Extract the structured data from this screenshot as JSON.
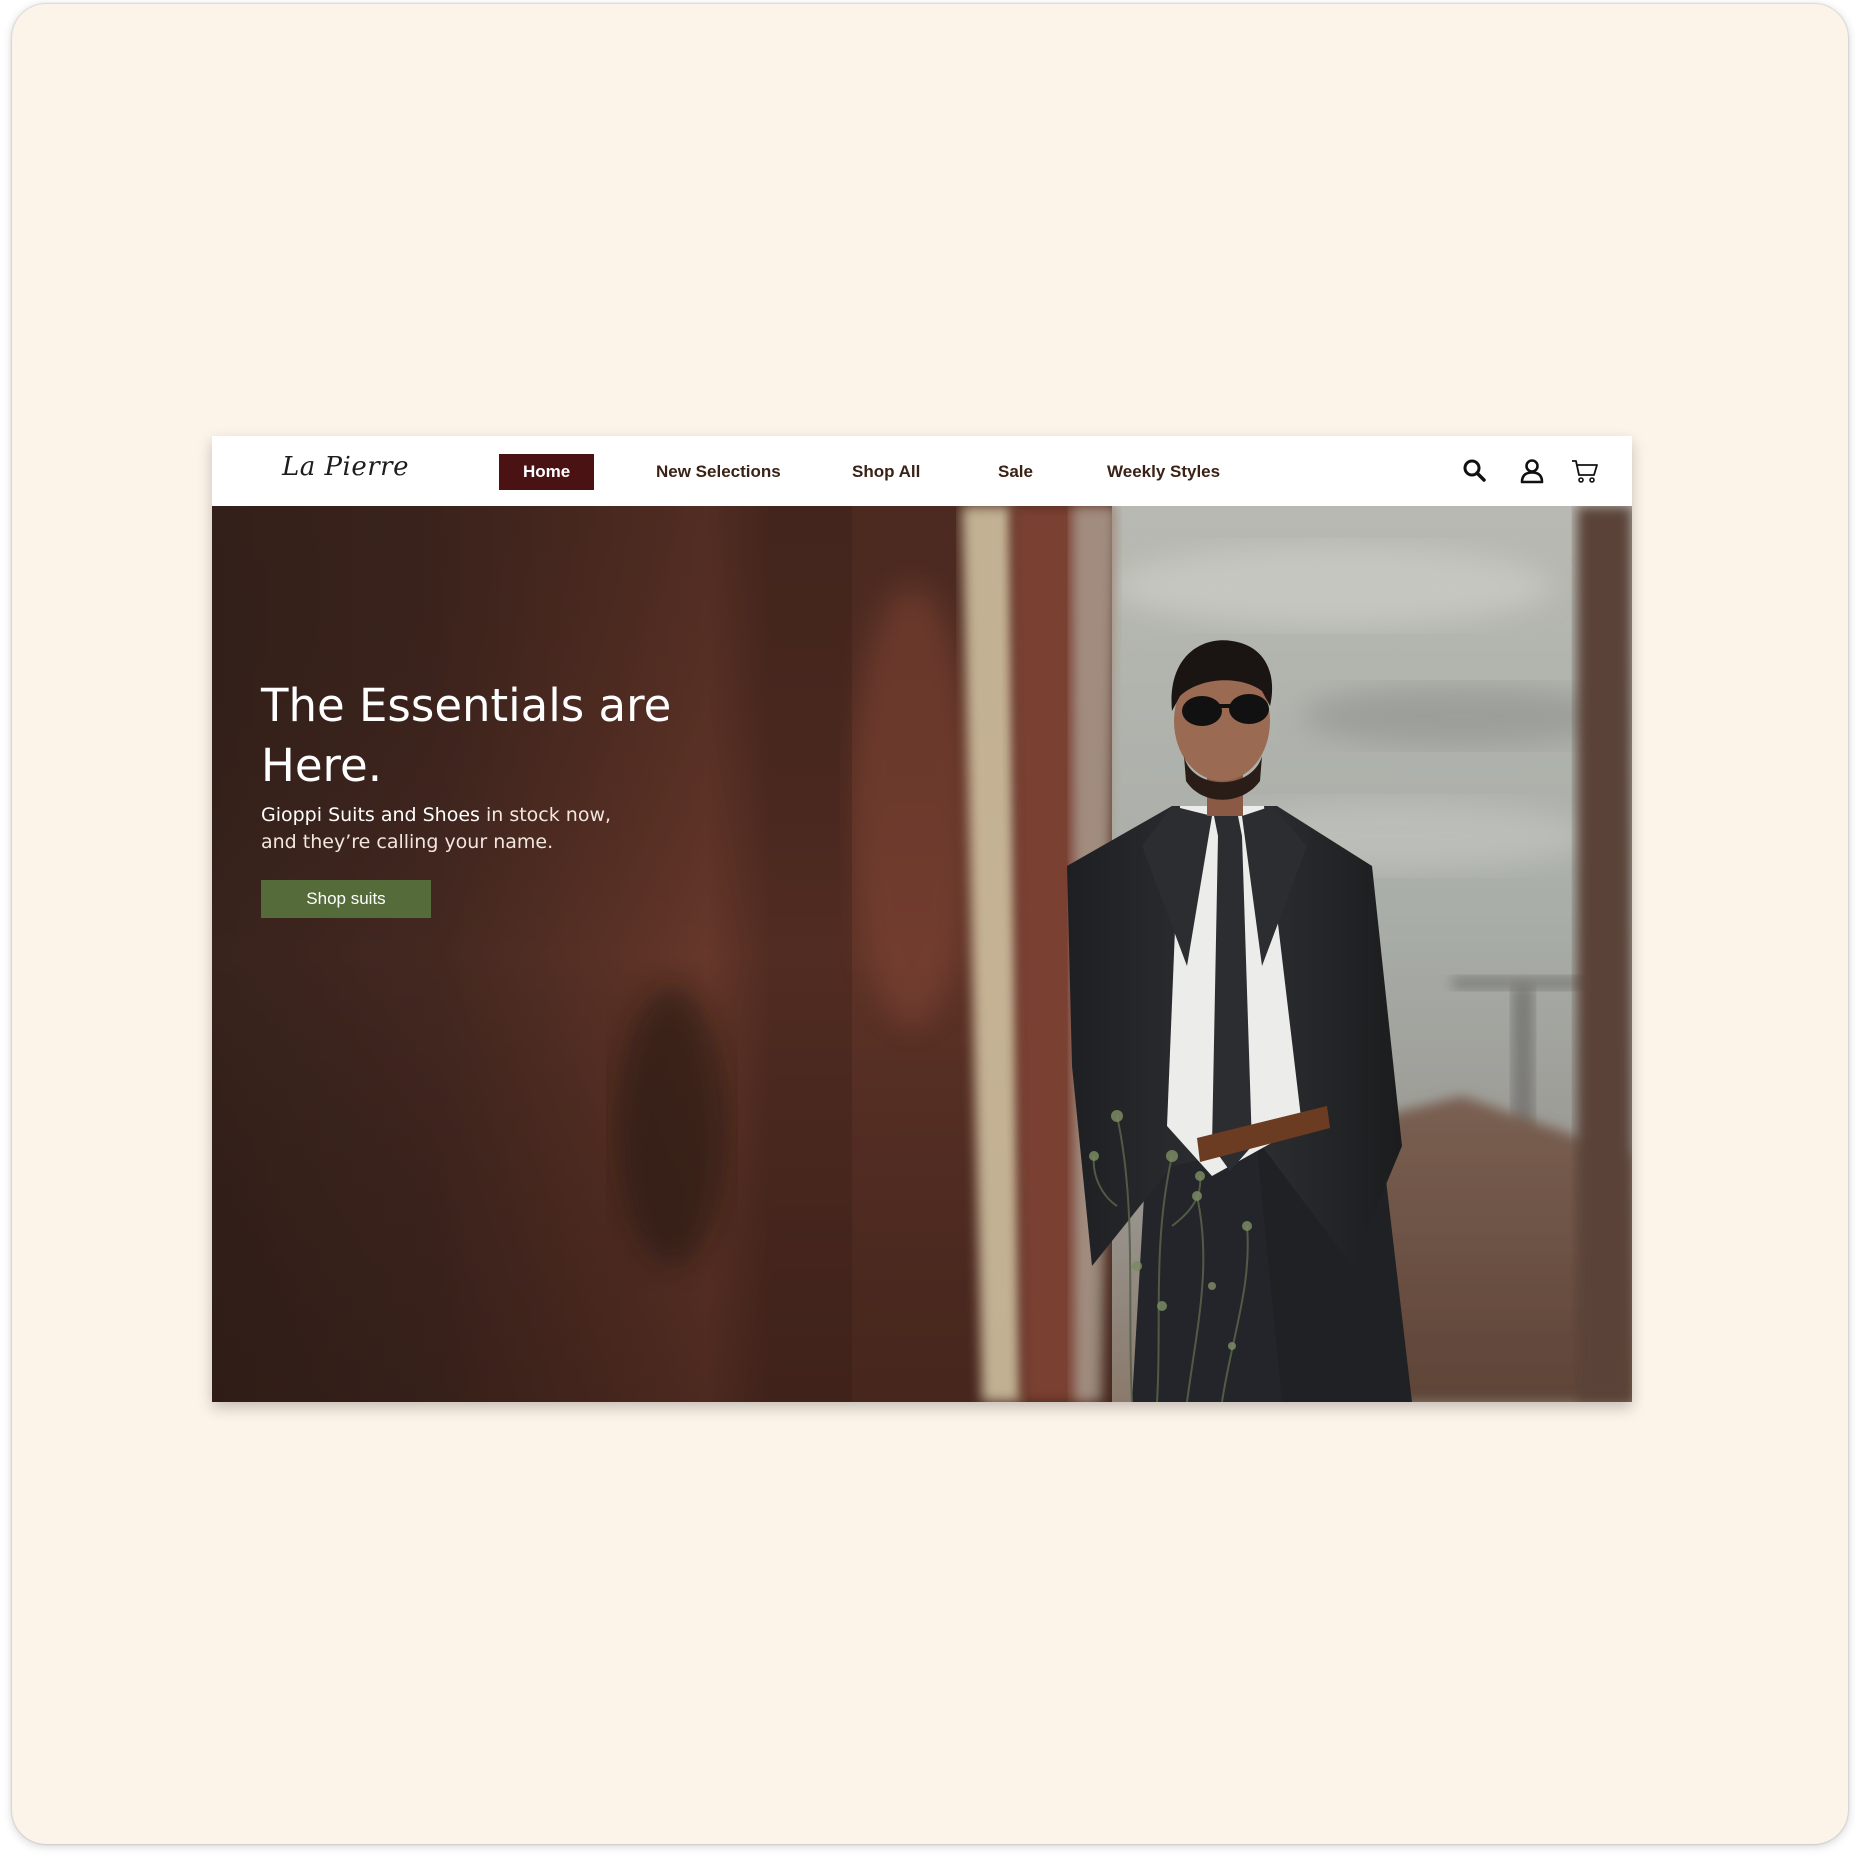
{
  "brand": {
    "logo_text": "La Pierre"
  },
  "nav": {
    "items": [
      {
        "label": "Home",
        "active": true
      },
      {
        "label": "New Selections",
        "active": false
      },
      {
        "label": "Shop All",
        "active": false
      },
      {
        "label": "Sale",
        "active": false
      },
      {
        "label": "Weekly Styles",
        "active": false
      }
    ],
    "icons": [
      "search-icon",
      "account-icon",
      "cart-icon"
    ]
  },
  "hero": {
    "headline": "The Essentials are Here.",
    "sub_strong": "Gioppi Suits and Shoes",
    "sub_rest": " in stock now, and they’re calling your name.",
    "cta_label": "Shop suits"
  },
  "colors": {
    "page_bg": "#fdf4e9",
    "nav_active_bg": "#4a1212",
    "nav_text": "#3a2216",
    "cta_bg": "#556b3a"
  }
}
